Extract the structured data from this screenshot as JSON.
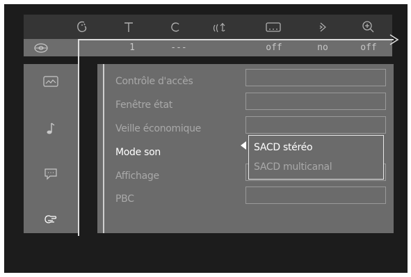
{
  "topbar": {
    "icons": [
      {
        "name": "disc-settings-icon",
        "glyph": "☉"
      },
      {
        "name": "title-icon",
        "glyph": "T"
      },
      {
        "name": "chapter-icon",
        "glyph": "C"
      },
      {
        "name": "audio-icon",
        "glyph": "((‹"
      },
      {
        "name": "subtitle-icon",
        "glyph": "…"
      },
      {
        "name": "angle-icon",
        "glyph": "▷"
      },
      {
        "name": "zoom-icon",
        "glyph": "⊕"
      }
    ]
  },
  "status": {
    "title": "1",
    "chapter": "---",
    "subtitle": "off",
    "angle": "no",
    "zoom": "off"
  },
  "sidebar": {
    "icons": [
      "picture-icon",
      "sound-icon",
      "language-icon",
      "features-icon"
    ]
  },
  "menu": {
    "items": [
      {
        "label": "Contrôle d'accès",
        "active": false
      },
      {
        "label": "Fenêtre état",
        "active": false
      },
      {
        "label": "Veille économique",
        "active": false
      },
      {
        "label": "Mode son",
        "active": true
      },
      {
        "label": "Affichage",
        "active": false
      },
      {
        "label": "PBC",
        "active": false
      }
    ]
  },
  "popup": {
    "options": [
      {
        "label": "SACD stéréo",
        "selected": true
      },
      {
        "label": "SACD multicanal",
        "selected": false
      }
    ]
  },
  "colors": {
    "screen": "#1c1c1c",
    "panel": "#6b6b6b",
    "topbar": "#353535",
    "active_text": "#ffffff",
    "inactive_text": "#a9a9a9"
  }
}
